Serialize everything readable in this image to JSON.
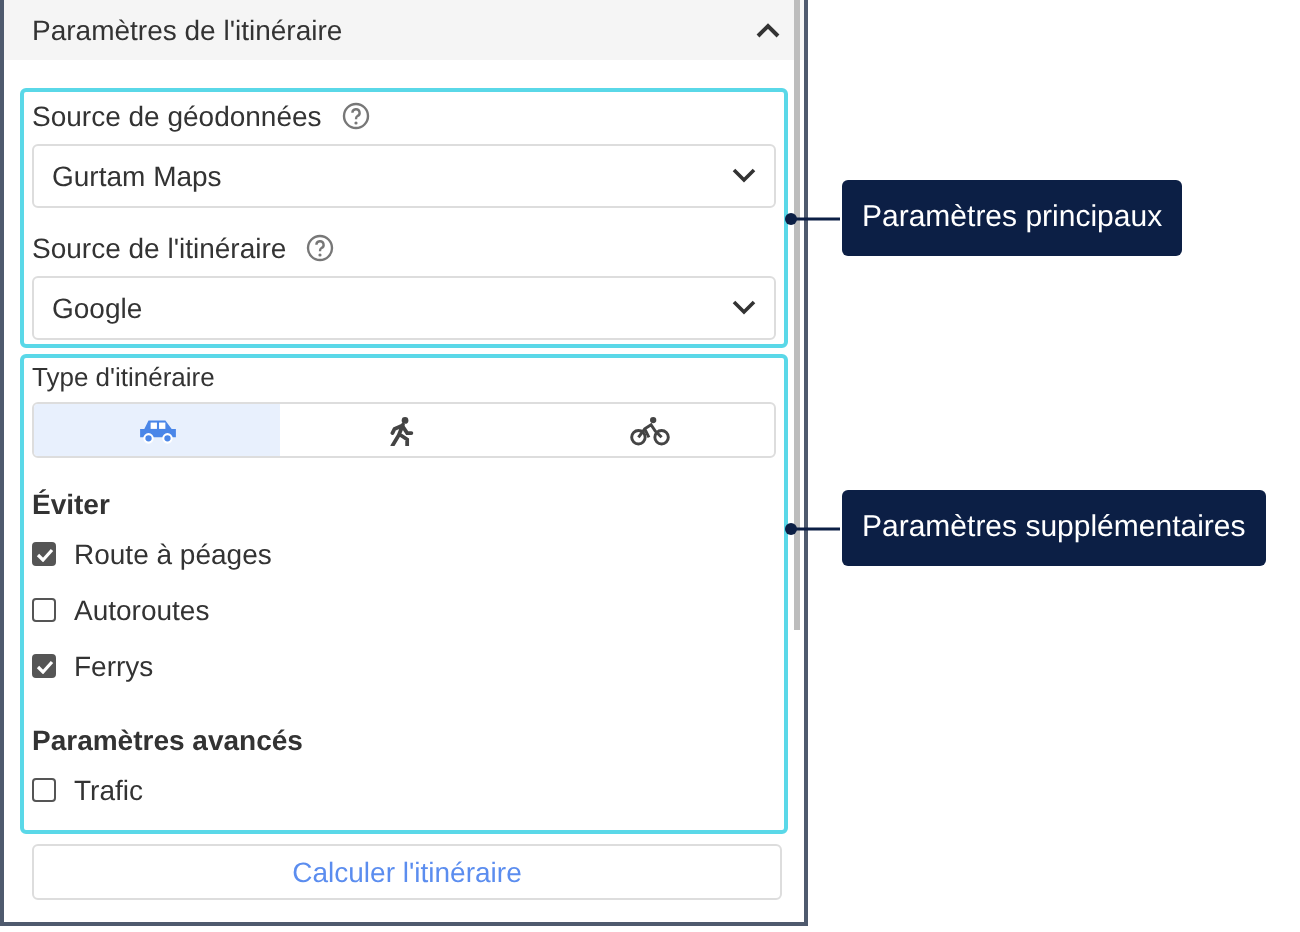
{
  "panel": {
    "title": "Paramètres de l'itinéraire",
    "expanded": true
  },
  "main_section": {
    "fields": [
      {
        "label": "Source de géodonnées",
        "value": "Gurtam Maps"
      },
      {
        "label": "Source de l'itinéraire",
        "value": "Google"
      }
    ]
  },
  "extra_section": {
    "route_type": {
      "label": "Type d'itinéraire",
      "options": [
        {
          "kind": "car",
          "selected": true
        },
        {
          "kind": "walk",
          "selected": false
        },
        {
          "kind": "bike",
          "selected": false
        }
      ]
    },
    "groups": [
      {
        "heading": "Éviter",
        "options": [
          {
            "label": "Route à péages",
            "checked": true
          },
          {
            "label": "Autoroutes",
            "checked": false
          },
          {
            "label": "Ferrys",
            "checked": true
          }
        ]
      },
      {
        "heading": "Paramètres avancés",
        "options": [
          {
            "label": "Trafic",
            "checked": false
          }
        ]
      }
    ]
  },
  "button": "Calculer l'itinéraire",
  "callouts": [
    {
      "label": "Paramètres principaux"
    },
    {
      "label": "Paramètres supplémentaires"
    }
  ]
}
